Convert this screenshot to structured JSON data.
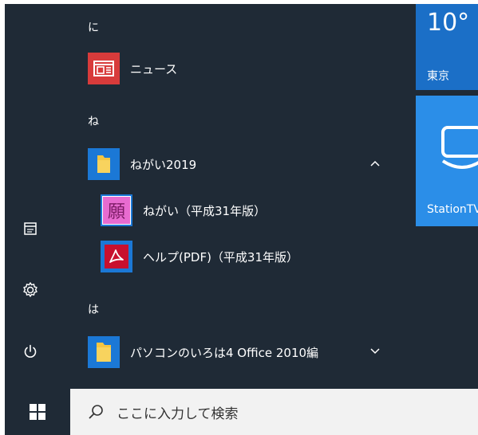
{
  "start_menu": {
    "sections": [
      {
        "letter": "に"
      },
      {
        "letter": "ね"
      },
      {
        "letter": "は"
      }
    ],
    "items": [
      {
        "label": "ニュース",
        "icon": "news-icon",
        "tile_color": "#d83b3b"
      },
      {
        "label": "ねがい2019",
        "icon": "folder-icon",
        "tile_color": "#1b78d6",
        "expanded": true
      },
      {
        "label": "ねがい（平成31年版）",
        "icon": "negai-app-icon",
        "tile_color": "#1b78d6",
        "glyph": "願"
      },
      {
        "label": "ヘルプ(PDF)（平成31年版）",
        "icon": "pdf-icon",
        "tile_color": "#1b78d6"
      },
      {
        "label": "パソコンのいろは4 Office 2010編",
        "icon": "folder-icon",
        "tile_color": "#1b78d6",
        "expanded": false
      }
    ],
    "rail": [
      {
        "name": "documents-icon"
      },
      {
        "name": "settings-icon"
      },
      {
        "name": "power-icon"
      }
    ]
  },
  "tiles": {
    "weather": {
      "temp": "10°",
      "city": "東京",
      "color": "#1b6fc7"
    },
    "station": {
      "label": "StationTV",
      "color": "#2b8ee8"
    }
  },
  "taskbar": {
    "search_placeholder": "ここに入力して検索"
  }
}
